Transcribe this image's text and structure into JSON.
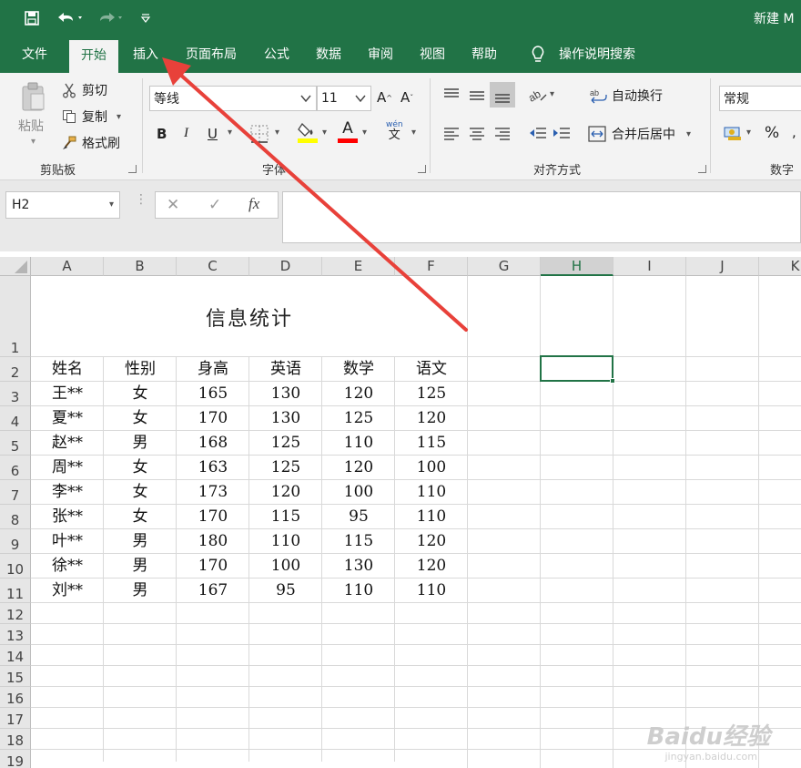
{
  "title_bar": {
    "save_icon": "save-icon",
    "undo_icon": "undo-icon",
    "redo_icon": "redo-icon",
    "customize_icon": "customize-icon",
    "doc_title": "新建 M"
  },
  "tabs": [
    {
      "label": "文件"
    },
    {
      "label": "开始",
      "active": true
    },
    {
      "label": "插入"
    },
    {
      "label": "页面布局"
    },
    {
      "label": "公式"
    },
    {
      "label": "数据"
    },
    {
      "label": "审阅"
    },
    {
      "label": "视图"
    },
    {
      "label": "帮助"
    },
    {
      "label": "操作说明搜索"
    }
  ],
  "ribbon": {
    "clipboard": {
      "paste": "粘贴",
      "cut": "剪切",
      "copy": "复制",
      "format_painter": "格式刷",
      "group_label": "剪贴板"
    },
    "font": {
      "font_name": "等线",
      "font_size": "11",
      "bold": "B",
      "italic": "I",
      "underline": "U",
      "font_color_letter": "A",
      "phonetic_top": "wén",
      "phonetic_bottom": "文",
      "group_label": "字体"
    },
    "alignment": {
      "wrap_text": "自动换行",
      "merge_center": "合并后居中",
      "group_label": "对齐方式"
    },
    "number": {
      "format": "常规",
      "percent": "%",
      "group_label": "数字"
    },
    "colors": {
      "accent": "#217346",
      "highlight": "#ffff00",
      "font_color": "#ff0000"
    }
  },
  "formula_bar": {
    "name_box": "H2",
    "cancel": "✕",
    "enter": "✓",
    "fx": "fx",
    "formula": ""
  },
  "sheet": {
    "columns": [
      "A",
      "B",
      "C",
      "D",
      "E",
      "F",
      "G",
      "H",
      "I",
      "J",
      "K"
    ],
    "selected_column": "H",
    "rows": [
      "1",
      "2",
      "3",
      "4",
      "5",
      "6",
      "7",
      "8",
      "9",
      "10",
      "11",
      "12",
      "13",
      "14",
      "15",
      "16",
      "17",
      "18",
      "19"
    ],
    "title": "信息统计",
    "header": [
      "姓名",
      "性别",
      "身高",
      "英语",
      "数学",
      "语文"
    ],
    "data": [
      [
        "王**",
        "女",
        "165",
        "130",
        "120",
        "125"
      ],
      [
        "夏**",
        "女",
        "170",
        "130",
        "125",
        "120"
      ],
      [
        "赵**",
        "男",
        "168",
        "125",
        "110",
        "115"
      ],
      [
        "周**",
        "女",
        "163",
        "125",
        "120",
        "100"
      ],
      [
        "李**",
        "女",
        "173",
        "120",
        "100",
        "110"
      ],
      [
        "张**",
        "女",
        "170",
        "115",
        "95",
        "110"
      ],
      [
        "叶**",
        "男",
        "180",
        "110",
        "115",
        "120"
      ],
      [
        "徐**",
        "男",
        "170",
        "100",
        "130",
        "120"
      ],
      [
        "刘**",
        "男",
        "167",
        "95",
        "110",
        "110"
      ]
    ]
  },
  "watermark": {
    "text": "Baidu经验",
    "sub": "jingyan.baidu.com"
  },
  "annotation_arrow_color": "#e8413a"
}
